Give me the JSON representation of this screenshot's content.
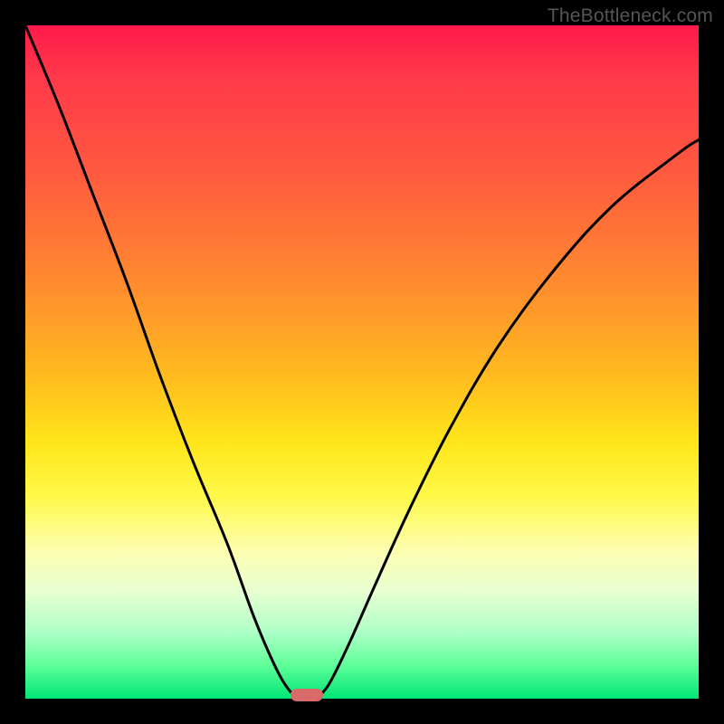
{
  "watermark": "TheBottleneck.com",
  "chart_data": {
    "type": "line",
    "title": "",
    "xlabel": "",
    "ylabel": "",
    "xlim": [
      0,
      100
    ],
    "ylim": [
      0,
      100
    ],
    "gradient_meaning": "bottleneck_severity",
    "gradient_stops": [
      {
        "pos": 0,
        "color": "#ff1a4a",
        "meaning": "high"
      },
      {
        "pos": 50,
        "color": "#ffe61a",
        "meaning": "medium"
      },
      {
        "pos": 100,
        "color": "#00e676",
        "meaning": "none"
      }
    ],
    "series": [
      {
        "name": "left-branch",
        "x": [
          0,
          5,
          10,
          15,
          20,
          25,
          30,
          34,
          37,
          39,
          40.5
        ],
        "y": [
          100,
          88,
          75,
          62,
          48,
          35,
          23,
          12,
          5,
          1.5,
          0
        ]
      },
      {
        "name": "right-branch",
        "x": [
          43,
          45,
          48,
          52,
          57,
          63,
          70,
          78,
          87,
          97,
          100
        ],
        "y": [
          0,
          2,
          8,
          17,
          28,
          40,
          52,
          63,
          73,
          81,
          83
        ]
      }
    ],
    "marker": {
      "x": 41.8,
      "y": 0.5,
      "color": "#d86a6a"
    }
  }
}
